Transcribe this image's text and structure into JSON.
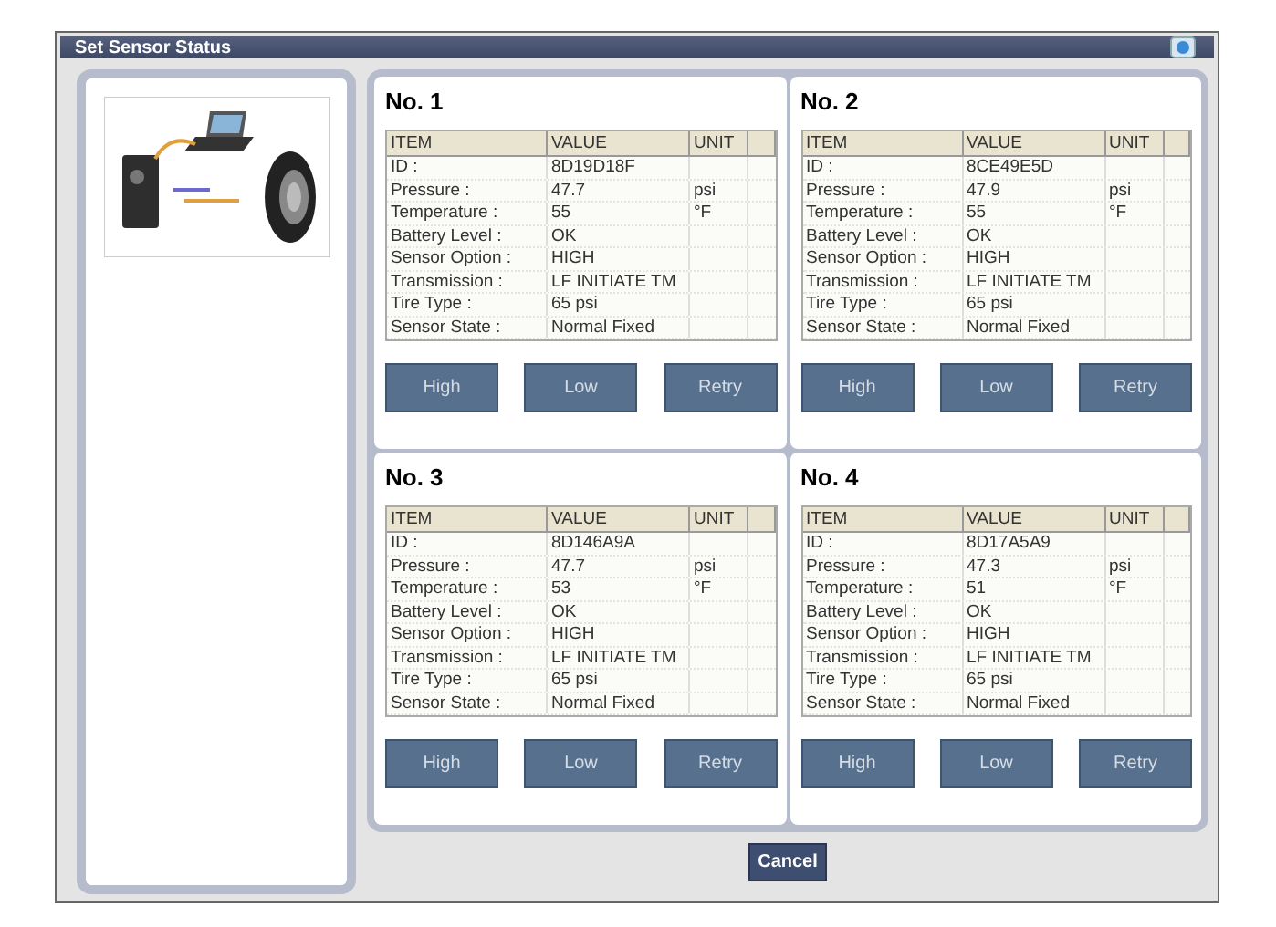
{
  "window": {
    "title": "Set Sensor Status"
  },
  "sensors": [
    {
      "title": "No. 1",
      "columns": [
        "ITEM",
        "VALUE",
        "UNIT"
      ],
      "rows": [
        {
          "item": "ID :",
          "value": "8D19D18F",
          "unit": ""
        },
        {
          "item": "Pressure :",
          "value": "47.7",
          "unit": "psi"
        },
        {
          "item": "Temperature :",
          "value": "55",
          "unit": "°F"
        },
        {
          "item": "Battery Level :",
          "value": "OK",
          "unit": ""
        },
        {
          "item": "Sensor Option :",
          "value": "HIGH",
          "unit": ""
        },
        {
          "item": "Transmission :",
          "value": "LF INITIATE TM",
          "unit": ""
        },
        {
          "item": "Tire Type :",
          "value": "65 psi",
          "unit": ""
        },
        {
          "item": "Sensor State :",
          "value": "Normal Fixed",
          "unit": ""
        }
      ],
      "buttons": [
        "High",
        "Low",
        "Retry"
      ]
    },
    {
      "title": "No. 2",
      "columns": [
        "ITEM",
        "VALUE",
        "UNIT"
      ],
      "rows": [
        {
          "item": "ID :",
          "value": "8CE49E5D",
          "unit": ""
        },
        {
          "item": "Pressure :",
          "value": "47.9",
          "unit": "psi"
        },
        {
          "item": "Temperature :",
          "value": "55",
          "unit": "°F"
        },
        {
          "item": "Battery Level :",
          "value": "OK",
          "unit": ""
        },
        {
          "item": "Sensor Option :",
          "value": "HIGH",
          "unit": ""
        },
        {
          "item": "Transmission :",
          "value": "LF INITIATE TM",
          "unit": ""
        },
        {
          "item": "Tire Type :",
          "value": "65 psi",
          "unit": ""
        },
        {
          "item": "Sensor State :",
          "value": "Normal Fixed",
          "unit": ""
        }
      ],
      "buttons": [
        "High",
        "Low",
        "Retry"
      ]
    },
    {
      "title": "No. 3",
      "columns": [
        "ITEM",
        "VALUE",
        "UNIT"
      ],
      "rows": [
        {
          "item": "ID :",
          "value": "8D146A9A",
          "unit": ""
        },
        {
          "item": "Pressure :",
          "value": "47.7",
          "unit": "psi"
        },
        {
          "item": "Temperature :",
          "value": "53",
          "unit": "°F"
        },
        {
          "item": "Battery Level :",
          "value": "OK",
          "unit": ""
        },
        {
          "item": "Sensor Option :",
          "value": "HIGH",
          "unit": ""
        },
        {
          "item": "Transmission :",
          "value": "LF INITIATE TM",
          "unit": ""
        },
        {
          "item": "Tire Type :",
          "value": "65 psi",
          "unit": ""
        },
        {
          "item": "Sensor State :",
          "value": "Normal Fixed",
          "unit": ""
        }
      ],
      "buttons": [
        "High",
        "Low",
        "Retry"
      ]
    },
    {
      "title": "No. 4",
      "columns": [
        "ITEM",
        "VALUE",
        "UNIT"
      ],
      "rows": [
        {
          "item": "ID :",
          "value": "8D17A5A9",
          "unit": ""
        },
        {
          "item": "Pressure :",
          "value": "47.3",
          "unit": "psi"
        },
        {
          "item": "Temperature :",
          "value": "51",
          "unit": "°F"
        },
        {
          "item": "Battery Level :",
          "value": "OK",
          "unit": ""
        },
        {
          "item": "Sensor Option :",
          "value": "HIGH",
          "unit": ""
        },
        {
          "item": "Transmission :",
          "value": "LF INITIATE TM",
          "unit": ""
        },
        {
          "item": "Tire Type :",
          "value": "65 psi",
          "unit": ""
        },
        {
          "item": "Sensor State :",
          "value": "Normal Fixed",
          "unit": ""
        }
      ],
      "buttons": [
        "High",
        "Low",
        "Retry"
      ]
    }
  ],
  "cancel_button": "Cancel"
}
